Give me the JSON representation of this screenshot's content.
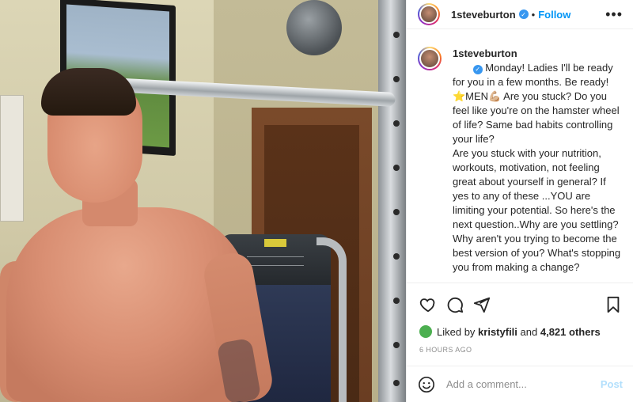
{
  "post": {
    "username": "1steveburton",
    "verified_glyph": "✓",
    "separator": "•",
    "follow_label": "Follow",
    "more_label": "•••"
  },
  "caption": {
    "username": "1steveburton",
    "text": "Monday! Ladies I'll be ready for you in a few months. Be ready! ⭐MEN💪🏼 Are you stuck? Do you feel like you're on the hamster wheel of life? Same bad habits controlling your life?\nAre you stuck with your nutrition, workouts, motivation, not feeling great about yourself in general? If yes to any of these ...YOU are limiting your potential. So here's the next question..Why are you settling? Why aren't you trying to become the best version of you? What's stopping you from making a change?\n\nI understand. I've been there. Believe it or not I struggled immensely with self esteem and self confidence for a long"
  },
  "actions": {
    "icons": [
      "heart-icon",
      "comment-icon",
      "share-icon",
      "bookmark-icon"
    ]
  },
  "likes": {
    "prefix": "Liked by",
    "user": "kristyfili",
    "middle": "and",
    "count": "4,821 others"
  },
  "timestamp": "6 HOURS AGO",
  "comment_box": {
    "placeholder": "Add a comment...",
    "post_label": "Post"
  },
  "colors": {
    "accent": "#0095f6",
    "verified": "#3897f0",
    "post_disabled": "#b2dffc",
    "muted": "#8e8e8e"
  }
}
